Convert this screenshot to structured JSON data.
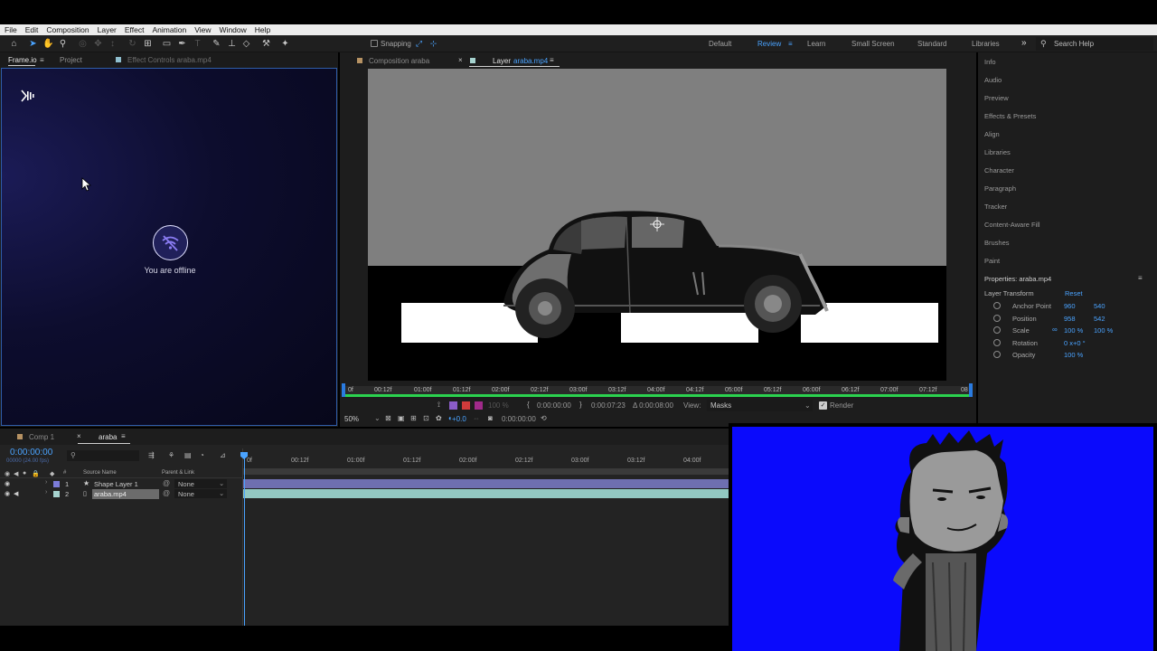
{
  "menu": [
    "File",
    "Edit",
    "Composition",
    "Layer",
    "Effect",
    "Animation",
    "View",
    "Window",
    "Help"
  ],
  "toolbar": {
    "snapping_label": "Snapping",
    "workspaces": [
      "Default",
      "Review",
      "Learn",
      "Small Screen",
      "Standard",
      "Libraries"
    ],
    "active_workspace": "Review",
    "search_placeholder": "Search Help"
  },
  "left_panel": {
    "tabs": [
      "Frame.io",
      "Project",
      "Effect Controls araba.mp4"
    ],
    "offline_text": "You are offline"
  },
  "viewer": {
    "tabs": {
      "composition": "Composition araba",
      "layer_prefix": "Layer",
      "layer_name": "araba.mp4"
    },
    "ruler_labels": [
      "0f",
      "00:12f",
      "01:00f",
      "01:12f",
      "02:00f",
      "02:12f",
      "03:00f",
      "03:12f",
      "04:00f",
      "04:12f",
      "05:00f",
      "05:12f",
      "06:00f",
      "06:12f",
      "07:00f",
      "07:12f",
      "08"
    ],
    "time_current": "0:00:00:00",
    "time_end": "0:00:07:23",
    "time_duration": "Δ 0:00:08:00",
    "zoom_pct": "100 %",
    "view_label": "View:",
    "view_value": "Masks",
    "render_label": "Render",
    "zoom": "50%",
    "exposure": "+0.0",
    "timecode2": "0:00:00:00"
  },
  "right_panel": {
    "items": [
      "Info",
      "Audio",
      "Preview",
      "Effects & Presets",
      "Align",
      "Libraries",
      "Character",
      "Paragraph",
      "Tracker",
      "Content-Aware Fill",
      "Brushes",
      "Paint"
    ],
    "properties_title": "Properties: araba.mp4",
    "layer_transform": "Layer Transform",
    "reset": "Reset",
    "props": [
      {
        "name": "Anchor Point",
        "v1": "960",
        "v2": "540"
      },
      {
        "name": "Position",
        "v1": "958",
        "v2": "542"
      },
      {
        "name": "Scale",
        "v1": "100 %",
        "v2": "100 %"
      },
      {
        "name": "Rotation",
        "v1": "0 x+0 °",
        "v2": ""
      },
      {
        "name": "Opacity",
        "v1": "100 %",
        "v2": ""
      }
    ]
  },
  "timeline": {
    "tabs": [
      "Comp 1",
      "araba"
    ],
    "timecode": "0:00:00:00",
    "fps": "00000 (24.00 fps)",
    "col_hash": "#",
    "col_source": "Source Name",
    "col_parent": "Parent & Link",
    "layers": [
      {
        "num": "1",
        "name": "Shape Layer 1",
        "parent": "None",
        "color": "#7b7bd8"
      },
      {
        "num": "2",
        "name": "araba.mp4",
        "parent": "None",
        "color": "#a6d3cf"
      }
    ],
    "ruler": [
      "0f",
      "00:12f",
      "01:00f",
      "01:12f",
      "02:00f",
      "02:12f",
      "03:00f",
      "03:12f",
      "04:00f"
    ]
  },
  "colors": {
    "accent_blue": "#4aa3ff",
    "panel_border": "#2f5da8",
    "green_track": "#2bd24f",
    "bluescreen": "#0a0afc"
  }
}
